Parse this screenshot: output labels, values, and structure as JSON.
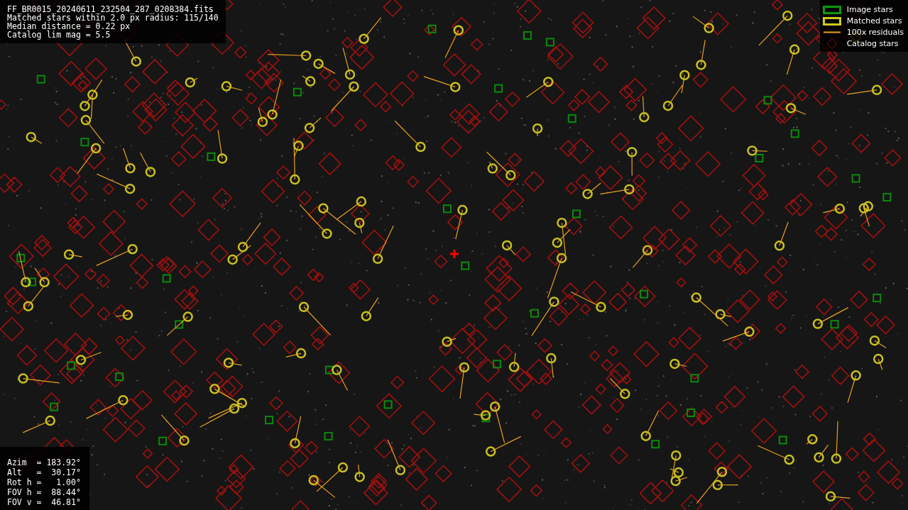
{
  "header": {
    "lines": [
      "FF_BR0015_20240611_232504_287_0208384.fits",
      "Matched stars within 2.0 px radius: 115/140",
      "Median distance = 0.22 px",
      "Catalog lim mag = 5.5"
    ]
  },
  "legend": [
    {
      "kind": "image",
      "label": "Image stars"
    },
    {
      "kind": "matched",
      "label": "Matched stars"
    },
    {
      "kind": "residual",
      "label": "100x residuals"
    },
    {
      "kind": "catalog",
      "label": "Catalog stars"
    }
  ],
  "pointing": {
    "lines": [
      "Azim  = 183.92°",
      "Alt   =  30.17°",
      "Rot h =   1.00°",
      "FOV h =  88.44°",
      "FOV v =  46.81°"
    ]
  }
}
